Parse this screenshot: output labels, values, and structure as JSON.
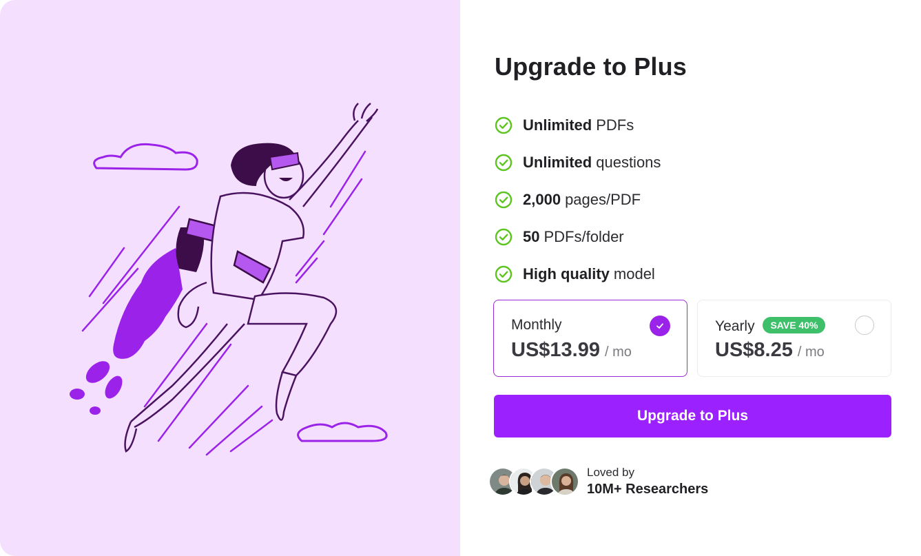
{
  "modal": {
    "title": "Upgrade to Plus",
    "features": [
      {
        "bold": "Unlimited",
        "text": "PDFs",
        "icon": "check-circle-icon"
      },
      {
        "bold": "Unlimited",
        "text": "questions",
        "icon": "check-circle-icon"
      },
      {
        "bold": "2,000",
        "text": "pages/PDF",
        "icon": "check-circle-icon"
      },
      {
        "bold": "50",
        "text": "PDFs/folder",
        "icon": "check-circle-icon"
      },
      {
        "bold": "High quality",
        "text": "model",
        "icon": "check-circle-icon"
      }
    ],
    "plans": {
      "monthly": {
        "name": "Monthly",
        "price": "US$13.99",
        "per": "/ mo",
        "selected": true
      },
      "yearly": {
        "name": "Yearly",
        "badge": "SAVE 40%",
        "price": "US$8.25",
        "per": "/ mo",
        "selected": false
      }
    },
    "cta_label": "Upgrade to Plus",
    "social": {
      "line1": "Loved by",
      "line2": "10M+ Researchers"
    }
  },
  "colors": {
    "accent": "#9b22ff",
    "illustration_bg": "#f4e0fe",
    "check": "#5cc41f",
    "badge": "#3ebf6a"
  }
}
